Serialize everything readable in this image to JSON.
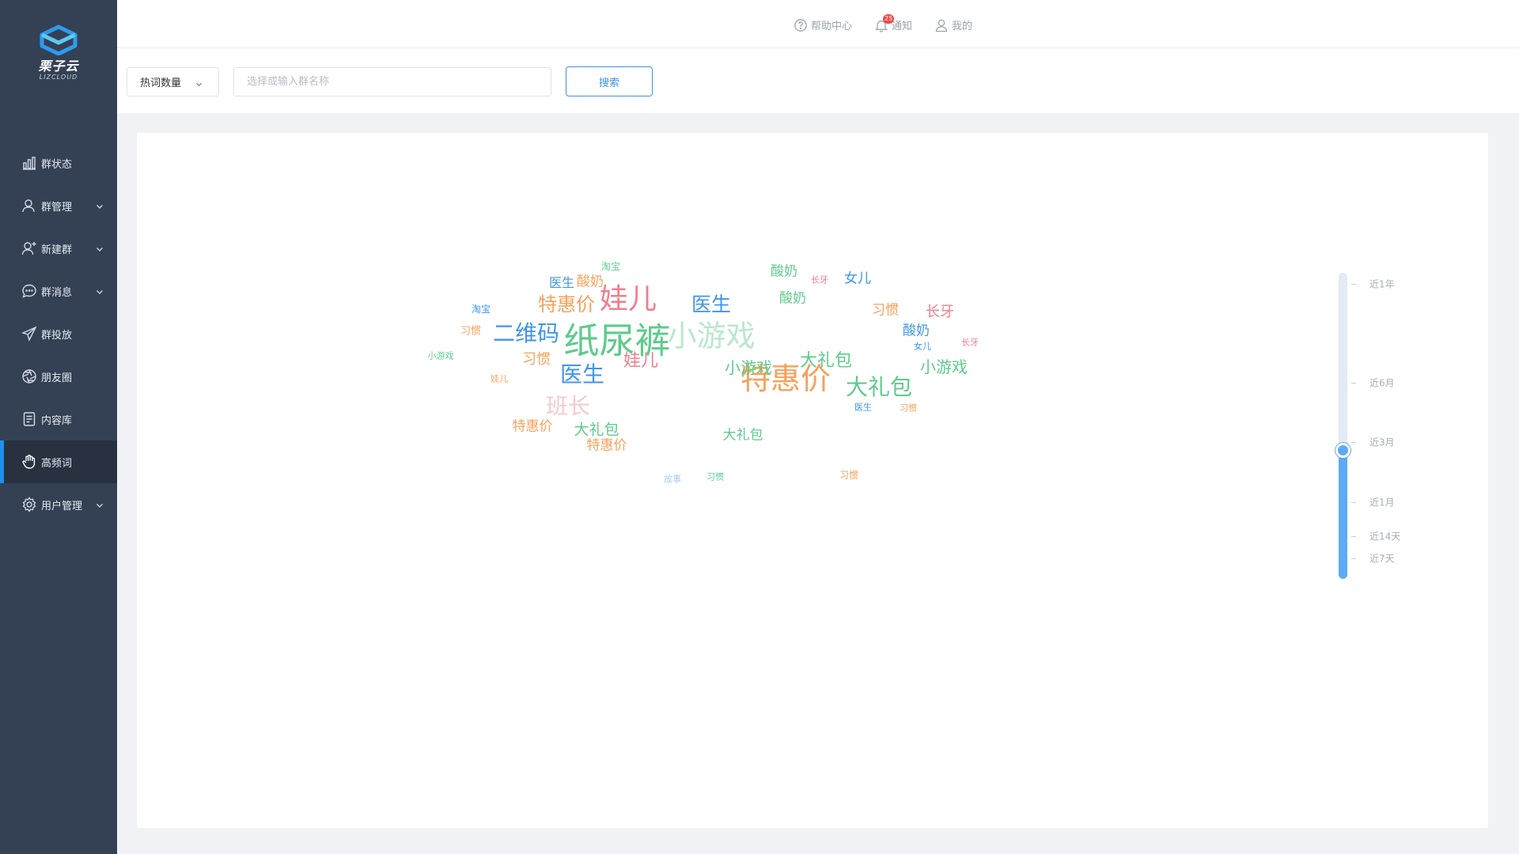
{
  "brand": {
    "name_cn": "栗子云",
    "name_en": "LIZCLOUD",
    "accent": "#2d9bf0"
  },
  "sidebar": {
    "items": [
      {
        "label": "群状态",
        "icon": "bar-chart-icon",
        "has_submenu": false,
        "active": false
      },
      {
        "label": "群管理",
        "icon": "user-icon",
        "has_submenu": true,
        "active": false
      },
      {
        "label": "新建群",
        "icon": "user-plus-icon",
        "has_submenu": true,
        "active": false
      },
      {
        "label": "群消息",
        "icon": "chat-bubble-icon",
        "has_submenu": true,
        "active": false
      },
      {
        "label": "群投放",
        "icon": "paper-plane-icon",
        "has_submenu": false,
        "active": false
      },
      {
        "label": "朋友圈",
        "icon": "aperture-icon",
        "has_submenu": false,
        "active": false
      },
      {
        "label": "内容库",
        "icon": "document-icon",
        "has_submenu": false,
        "active": false
      },
      {
        "label": "高频词",
        "icon": "hand-icon",
        "has_submenu": false,
        "active": true
      },
      {
        "label": "用户管理",
        "icon": "gear-icon",
        "has_submenu": true,
        "active": false
      }
    ]
  },
  "header": {
    "help_label": "帮助中心",
    "notify_label": "通知",
    "notify_count": "25",
    "mine_label": "我的"
  },
  "filter": {
    "select_value": "热词数量",
    "search_placeholder": "选择或输入群名称",
    "search_button": "搜索"
  },
  "colors": {
    "green": "#5dcb8c",
    "blue": "#3d95ec",
    "orange": "#f5a15a",
    "pink": "#f27d8e",
    "pale_green": "#b9e8cb",
    "pale_pink": "#f8c8cf",
    "pale_blue": "#a9cdf4"
  },
  "wordcloud": [
    {
      "text": "纸尿裤",
      "color": "green"
    },
    {
      "text": "小游戏",
      "color": "pale_green"
    },
    {
      "text": "二维码",
      "color": "blue"
    },
    {
      "text": "娃儿",
      "color": "pink"
    },
    {
      "text": "特惠价",
      "color": "orange"
    },
    {
      "text": "特惠价",
      "color": "orange"
    },
    {
      "text": "医生",
      "color": "blue"
    },
    {
      "text": "医生",
      "color": "blue"
    },
    {
      "text": "大礼包",
      "color": "green"
    },
    {
      "text": "大礼包",
      "color": "green"
    },
    {
      "text": "小游戏",
      "color": "green"
    },
    {
      "text": "小游戏",
      "color": "green"
    },
    {
      "text": "班长",
      "color": "pale_pink"
    },
    {
      "text": "娃儿",
      "color": "pink"
    },
    {
      "text": "大礼包",
      "color": "green"
    },
    {
      "text": "大礼包",
      "color": "green"
    },
    {
      "text": "习惯",
      "color": "orange"
    },
    {
      "text": "特惠价",
      "color": "orange"
    },
    {
      "text": "特惠价",
      "color": "orange"
    },
    {
      "text": "长牙",
      "color": "pink"
    },
    {
      "text": "女儿",
      "color": "blue"
    },
    {
      "text": "酸奶",
      "color": "green"
    },
    {
      "text": "酸奶",
      "color": "green"
    },
    {
      "text": "酸奶",
      "color": "orange"
    },
    {
      "text": "酸奶",
      "color": "blue"
    },
    {
      "text": "习惯",
      "color": "orange"
    },
    {
      "text": "医生",
      "color": "blue"
    },
    {
      "text": "淘宝",
      "color": "green"
    },
    {
      "text": "淘宝",
      "color": "blue"
    },
    {
      "text": "长牙",
      "color": "pink"
    },
    {
      "text": "习惯",
      "color": "orange"
    },
    {
      "text": "习惯",
      "color": "orange"
    },
    {
      "text": "女儿",
      "color": "blue"
    },
    {
      "text": "小游戏",
      "color": "green"
    },
    {
      "text": "娃儿",
      "color": "orange"
    },
    {
      "text": "医生",
      "color": "blue"
    },
    {
      "text": "长牙",
      "color": "pink"
    },
    {
      "text": "故事",
      "color": "pale_blue"
    },
    {
      "text": "习惯",
      "color": "green"
    },
    {
      "text": "习惯",
      "color": "orange"
    }
  ],
  "time_range": {
    "ticks": [
      "近1年",
      "近6月",
      "近3月",
      "近1月",
      "近14天",
      "近7天"
    ],
    "selected": "近3月",
    "selected_fraction": 0.42
  }
}
